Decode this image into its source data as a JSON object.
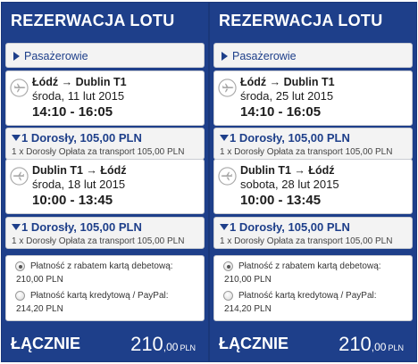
{
  "panels": [
    {
      "title": "REZERWACJA LOTU",
      "passengers_header": "Pasażerowie",
      "flights": [
        {
          "route": "Łódź → Dublin T1",
          "date": "środa, 11 lut 2015",
          "time": "14:10 - 16:05",
          "price_summary": "1 Dorosły, 105,00 PLN",
          "price_detail": "1 x Dorosły Opłata za transport 105,00 PLN"
        },
        {
          "route": "Dublin T1 → Łódź",
          "date": "środa, 18 lut 2015",
          "time": "10:00 - 13:45",
          "price_summary": "1 Dorosły, 105,00 PLN",
          "price_detail": "1 x Dorosły Opłata za transport 105,00 PLN"
        }
      ],
      "payment_options": [
        {
          "label": "Płatność z rabatem kartą debetową:",
          "amount": "210,00 PLN",
          "selected": true
        },
        {
          "label": "Płatność kartą kredytową / PayPal:",
          "amount": "214,20 PLN",
          "selected": false
        }
      ],
      "total": {
        "label": "ŁĄCZNIE",
        "integer": "210",
        "decimal": ",00",
        "currency": "PLN"
      }
    },
    {
      "title": "REZERWACJA LOTU",
      "passengers_header": "Pasażerowie",
      "flights": [
        {
          "route": "Łódź → Dublin T1",
          "date": "środa, 25 lut 2015",
          "time": "14:10 - 16:05",
          "price_summary": "1 Dorosły, 105,00 PLN",
          "price_detail": "1 x Dorosły Opłata za transport 105,00 PLN"
        },
        {
          "route": "Dublin T1 → Łódź",
          "date": "sobota, 28 lut 2015",
          "time": "10:00 - 13:45",
          "price_summary": "1 Dorosły, 105,00 PLN",
          "price_detail": "1 x Dorosły Opłata za transport 105,00 PLN"
        }
      ],
      "payment_options": [
        {
          "label": "Płatność z rabatem kartą debetową:",
          "amount": "210,00 PLN",
          "selected": true
        },
        {
          "label": "Płatność kartą kredytową / PayPal:",
          "amount": "214,20 PLN",
          "selected": false
        }
      ],
      "total": {
        "label": "ŁĄCZNIE",
        "integer": "210",
        "decimal": ",00",
        "currency": "PLN"
      }
    }
  ],
  "icons": {
    "flight": "airplane-icon",
    "expand": "triangle-right-icon",
    "collapse": "triangle-down-icon"
  },
  "colors": {
    "panel_bg": "#1e3f8a",
    "accent_text": "#1e3f8a",
    "box_bg": "#f3f3f3"
  }
}
